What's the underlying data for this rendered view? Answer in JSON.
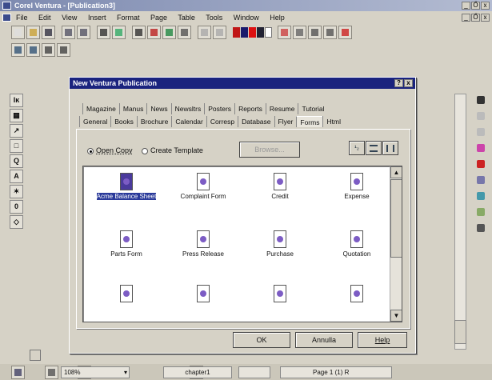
{
  "app": {
    "title": "Corel Ventura - [Publication3]"
  },
  "window_buttons": {
    "minimize": "_",
    "restore": "Ő",
    "close": "x"
  },
  "menu": [
    "File",
    "Edit",
    "View",
    "Insert",
    "Format",
    "Page",
    "Table",
    "Tools",
    "Window",
    "Help"
  ],
  "left_tools": [
    "Iĸ",
    "▦",
    "↗",
    "□",
    "Q",
    "A",
    "✶",
    "0",
    "◇"
  ],
  "dialog": {
    "title": "New Ventura Publication",
    "help_btn": "?",
    "close_btn": "x",
    "tabs_row1": [
      "Magazine",
      "Manus",
      "News",
      "Newsltrs",
      "Posters",
      "Reports",
      "Resume",
      "Tutorial"
    ],
    "tabs_row2": [
      "General",
      "Books",
      "Brochure",
      "Calendar",
      "Corresp",
      "Database",
      "Flyer",
      "Forms",
      "Html"
    ],
    "active_tab": "Forms",
    "radio_open": "Open Copy",
    "radio_create": "Create Template",
    "browse_label": "Browse...",
    "view_btn1": "¹₂",
    "items": [
      {
        "label": "Acme Balance Sheet",
        "selected": true
      },
      {
        "label": "Complaint Form",
        "selected": false
      },
      {
        "label": "Credit",
        "selected": false
      },
      {
        "label": "Expense",
        "selected": false
      },
      {
        "label": "Parts Form",
        "selected": false
      },
      {
        "label": "Press Release",
        "selected": false
      },
      {
        "label": "Purchase",
        "selected": false
      },
      {
        "label": "Quotation",
        "selected": false
      },
      {
        "label": "",
        "selected": false
      },
      {
        "label": "",
        "selected": false
      },
      {
        "label": "",
        "selected": false
      },
      {
        "label": "",
        "selected": false
      }
    ],
    "ok_label": "OK",
    "cancel_label": "Annulla",
    "help_label": "Help"
  },
  "status": {
    "zoom": "108%",
    "chapter": "chapter1",
    "page": "Page 1 (1)  R"
  },
  "colors": {
    "title_start": "#7d8ab0",
    "dialog_title": "#1a237e",
    "selection": "#2a3a9a"
  }
}
